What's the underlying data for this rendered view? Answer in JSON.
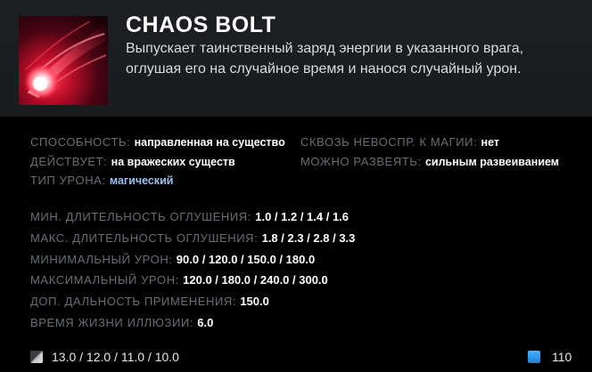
{
  "ability": {
    "name": "CHAOS BOLT",
    "description": "Выпускает таинственный заряд энергии в указанного врага, оглушая его на случайное время и нанося случайный урон.",
    "icon": "chaos-bolt-icon"
  },
  "properties": {
    "ability_label": "СПОСОБНОСТЬ:",
    "ability_value": "направленная на существо",
    "affects_label": "ДЕЙСТВУЕТ:",
    "affects_value": "на вражеских существ",
    "damage_type_label": "ТИП УРОНА:",
    "damage_type_value": "магический",
    "pierces_label": "СКВОЗЬ НЕВОСПР. К МАГИИ:",
    "pierces_value": "нет",
    "dispel_label": "МОЖНО РАЗВЕЯТЬ:",
    "dispel_value": "сильным развеиванием"
  },
  "stats": [
    {
      "label": "МИН. ДЛИТЕЛЬНОСТЬ ОГЛУШЕНИЯ:",
      "value": "1.0 / 1.2 / 1.4 / 1.6"
    },
    {
      "label": "МАКС. ДЛИТЕЛЬНОСТЬ ОГЛУШЕНИЯ:",
      "value": "1.8 / 2.3 / 2.8 / 3.3"
    },
    {
      "label": "МИНИМАЛЬНЫЙ УРОН:",
      "value": "90.0 / 120.0 / 150.0 / 180.0"
    },
    {
      "label": "МАКСИМАЛЬНЫЙ УРОН:",
      "value": "120.0 / 180.0 / 240.0 / 300.0"
    },
    {
      "label": "ДОП. ДАЛЬНОСТЬ ПРИМЕНЕНИЯ:",
      "value": "150.0"
    },
    {
      "label": "ВРЕМЯ ЖИЗНИ ИЛЛЮЗИИ:",
      "value": "6.0"
    }
  ],
  "footer": {
    "cooldown": "13.0 / 12.0 / 11.0 / 10.0",
    "cooldown_icon": "cooldown-icon",
    "mana_cost": "110",
    "mana_icon": "mana-icon"
  },
  "colors": {
    "header_bg": "#1d1f22",
    "body_bg": "#000000",
    "label": "#6a6e73",
    "value": "#ffffff",
    "magic_damage": "#9bc0e8",
    "mana": "#2a8fe6"
  }
}
